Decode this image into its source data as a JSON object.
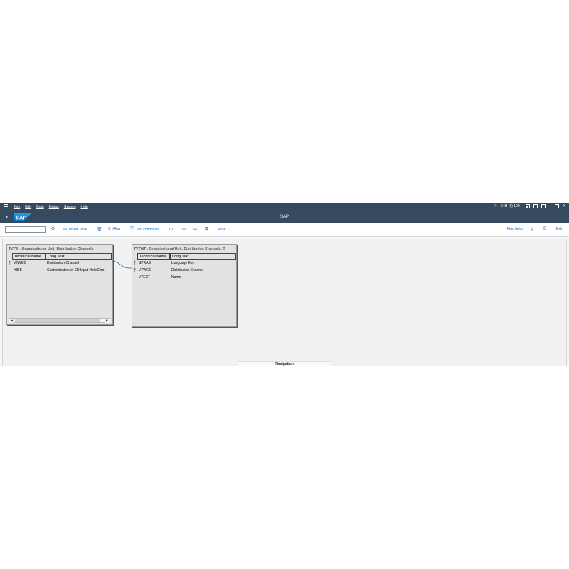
{
  "menubar": {
    "items": [
      "Join",
      "Edit",
      "Goto",
      "Extras",
      "System",
      "Help"
    ],
    "system_info": "S4H (1) 100",
    "chevron": ">"
  },
  "titlebar": {
    "title": "SAP",
    "back": "<",
    "logo_text": "SAP"
  },
  "toolbar": {
    "select_value": "",
    "insert_table": "Insert Table",
    "alias": "Alias",
    "join_conditions": "Join conditions",
    "more": "More",
    "find_fields": "Find fields",
    "exit": "Exit"
  },
  "tables": [
    {
      "header": "TVTW : Organizational Unit: Distribution Channels",
      "col_technical": "Technical Name",
      "col_long": "Long Text",
      "rows": [
        {
          "name": "VTWEG",
          "text": "Distribution Channel",
          "key": true
        },
        {
          "name": "HIDE",
          "text": "Customization of SD Input Help Erro",
          "key": false
        }
      ]
    },
    {
      "header": "TVTWT : Organizational Unit: Distribution Channels: T",
      "col_technical": "Technical Name",
      "col_long": "Long Text",
      "rows": [
        {
          "name": "SPRAS",
          "text": "Language Key",
          "key": true
        },
        {
          "name": "VTWEG",
          "text": "Distribution Channel",
          "key": true
        },
        {
          "name": "VTEXT",
          "text": "Name",
          "key": false
        }
      ]
    }
  ],
  "navigation_label": "Navigation",
  "colors": {
    "shell": "#354a5f",
    "accent": "#0a6ed1"
  }
}
